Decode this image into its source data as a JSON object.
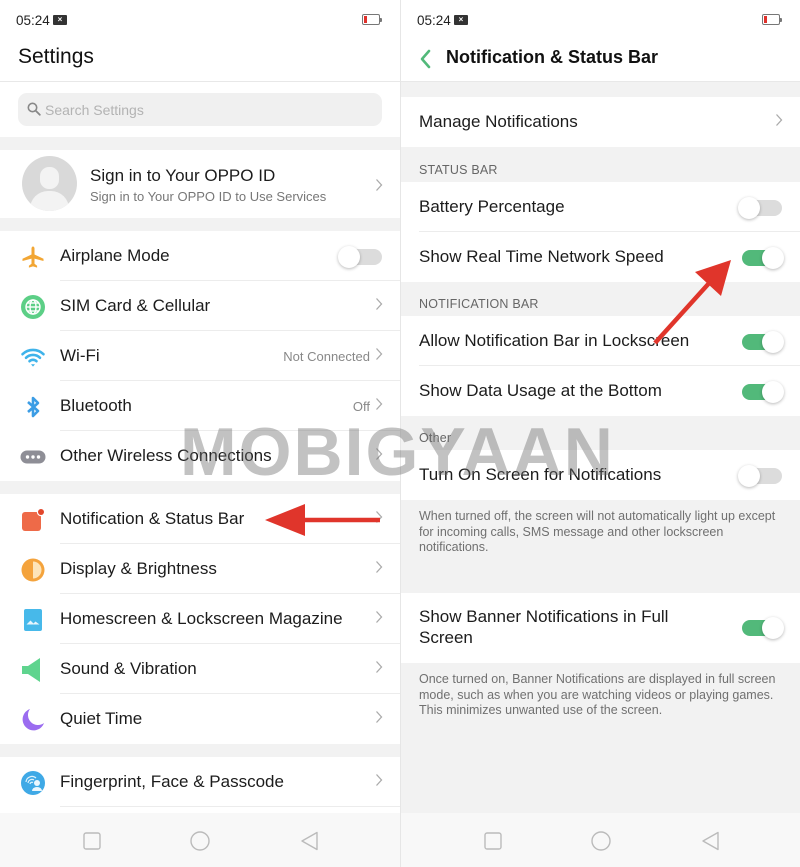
{
  "left_screen": {
    "status_bar": {
      "time": "05:24",
      "notification_icon": "x-box-icon",
      "battery_color": "#e0312b"
    },
    "title": "Settings",
    "search": {
      "placeholder": "Search Settings",
      "value": ""
    },
    "account": {
      "title": "Sign in to Your OPPO ID",
      "subtitle": "Sign in to Your OPPO ID to Use Services"
    },
    "connectivity": [
      {
        "label": "Airplane Mode",
        "icon": "airplane-icon",
        "icon_color": "#f2a634",
        "toggle": false
      },
      {
        "label": "SIM Card & Cellular",
        "icon": "globe-icon",
        "icon_color": "#5ccf86",
        "value": ""
      },
      {
        "label": "Wi-Fi",
        "icon": "wifi-icon",
        "icon_color": "#3fb3ea",
        "value": "Not Connected"
      },
      {
        "label": "Bluetooth",
        "icon": "bluetooth-icon",
        "icon_color": "#3c9de5",
        "value": "Off"
      },
      {
        "label": "Other Wireless Connections",
        "icon": "more-dots-icon",
        "icon_color": "#8e8e96",
        "value": ""
      }
    ],
    "personalization": [
      {
        "label": "Notification & Status Bar",
        "icon": "notification-icon",
        "icon_color": "#ee6a48",
        "highlighted": true
      },
      {
        "label": "Display & Brightness",
        "icon": "brightness-icon",
        "icon_color": "#f4a33c"
      },
      {
        "label": "Homescreen & Lockscreen Magazine",
        "icon": "wallpaper-icon",
        "icon_color": "#47b9ea"
      },
      {
        "label": "Sound & Vibration",
        "icon": "speaker-icon",
        "icon_color": "#5fd48e"
      },
      {
        "label": "Quiet Time",
        "icon": "moon-icon",
        "icon_color": "#9b6cf0"
      }
    ],
    "security": [
      {
        "label": "Fingerprint, Face & Passcode",
        "icon": "fingerprint-face-icon",
        "icon_color": "#3fa9e6"
      }
    ]
  },
  "right_screen": {
    "status_bar": {
      "time": "05:24",
      "notification_icon": "x-box-icon",
      "battery_color": "#e0312b"
    },
    "title": "Notification & Status Bar",
    "back_color": "#52b97a",
    "manage_notifications": "Manage Notifications",
    "sections": {
      "status_bar": {
        "label": "STATUS BAR",
        "items": [
          {
            "label": "Battery Percentage",
            "toggle": false
          },
          {
            "label": "Show Real Time Network Speed",
            "toggle": true,
            "highlighted": true
          }
        ]
      },
      "notification_bar": {
        "label": "NOTIFICATION BAR",
        "items": [
          {
            "label": "Allow Notification Bar in Lockscreen",
            "toggle": true
          },
          {
            "label": "Show Data Usage at the Bottom",
            "toggle": true
          }
        ]
      },
      "other": {
        "label": "Other",
        "items": [
          {
            "label": "Turn On Screen for Notifications",
            "toggle": false,
            "note": "When turned off, the screen will not automatically light up except for incoming calls, SMS message and other lockscreen notifications."
          },
          {
            "label": "Show Banner Notifications in Full Screen",
            "toggle": true,
            "note": "Once turned on, Banner Notifications are displayed in full screen mode, such as when you are watching videos or playing games. This minimizes unwanted use of the screen."
          }
        ]
      }
    }
  },
  "navigation_bar": {
    "buttons": [
      "recents-square-icon",
      "home-circle-icon",
      "back-triangle-icon"
    ]
  },
  "watermark": {
    "text": "MOBIGYAAN"
  },
  "annotation": {
    "arrow_color": "#e0352b"
  },
  "accent_colors": {
    "toggle_on": "#52b97a",
    "toggle_off": "#dcdcdc"
  }
}
